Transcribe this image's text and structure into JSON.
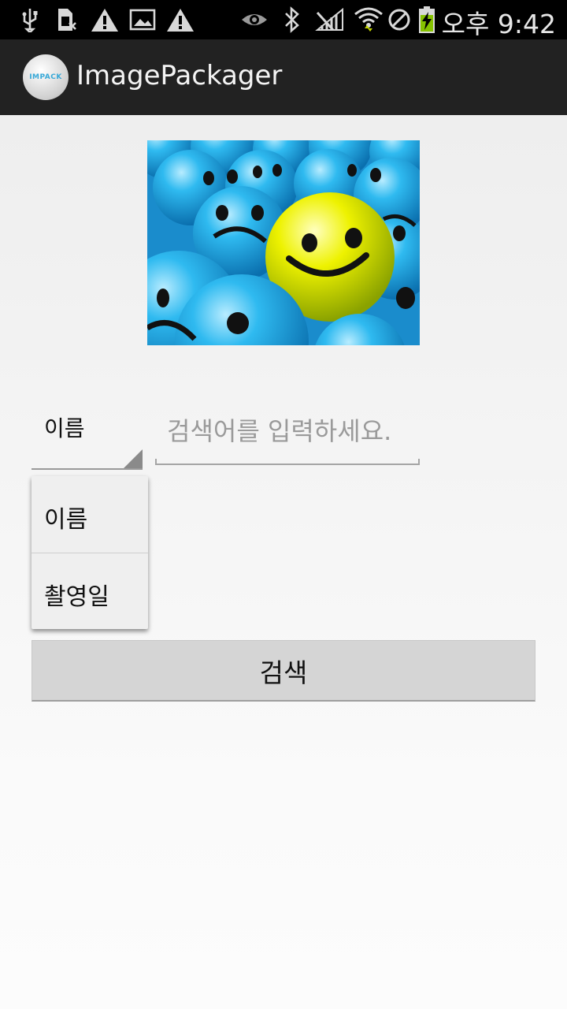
{
  "status_bar": {
    "time": "오후 9:42",
    "left_icons": [
      "usb-icon",
      "sim-card-icon",
      "warning-icon",
      "image-icon",
      "warning-icon"
    ],
    "right_icons": [
      "eye-icon",
      "bluetooth-icon",
      "no-signal-icon",
      "wifi-icon",
      "blocked-icon",
      "battery-charging-icon"
    ]
  },
  "action_bar": {
    "title": "ImagePackager",
    "logo_text": "IMPACK"
  },
  "hero_image": {
    "description_icon": "smiley-balls-image"
  },
  "spinner": {
    "selected": "이름"
  },
  "search": {
    "placeholder": "검색어를 입력하세요."
  },
  "dropdown": {
    "options": [
      "이름",
      "촬영일"
    ]
  },
  "search_button": {
    "label": "검색"
  },
  "colors": {
    "status_bar": "#000000",
    "action_bar": "#222222",
    "button": "#d5d5d5",
    "ball_blue": "#29b6f0",
    "ball_yellow": "#e8f000"
  }
}
